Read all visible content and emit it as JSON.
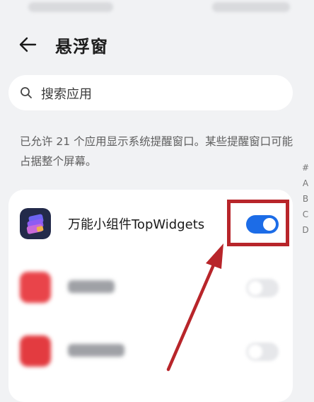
{
  "header": {
    "title": "悬浮窗",
    "back_icon": "arrow-left-icon"
  },
  "search": {
    "placeholder": "搜索应用",
    "icon": "search-icon"
  },
  "description": "已允许 21 个应用显示系统提醒窗口。某些提醒窗口可能占据整个屏幕。",
  "index_bar": [
    "#",
    "A",
    "B",
    "C",
    "D"
  ],
  "apps": [
    {
      "name": "万能小组件TopWidgets",
      "enabled": true,
      "icon": "topwidgets-app-icon",
      "icon_color": "#5b57e8"
    },
    {
      "name": "",
      "enabled": false,
      "icon": "blurred-app-icon",
      "icon_color": "#e9444a"
    },
    {
      "name": "",
      "enabled": false,
      "icon": "blurred-app-icon",
      "icon_color": "#e33b40"
    }
  ],
  "colors": {
    "accent": "#1c6ce7",
    "annotation": "#b8252a",
    "background": "#f1f2f4"
  }
}
